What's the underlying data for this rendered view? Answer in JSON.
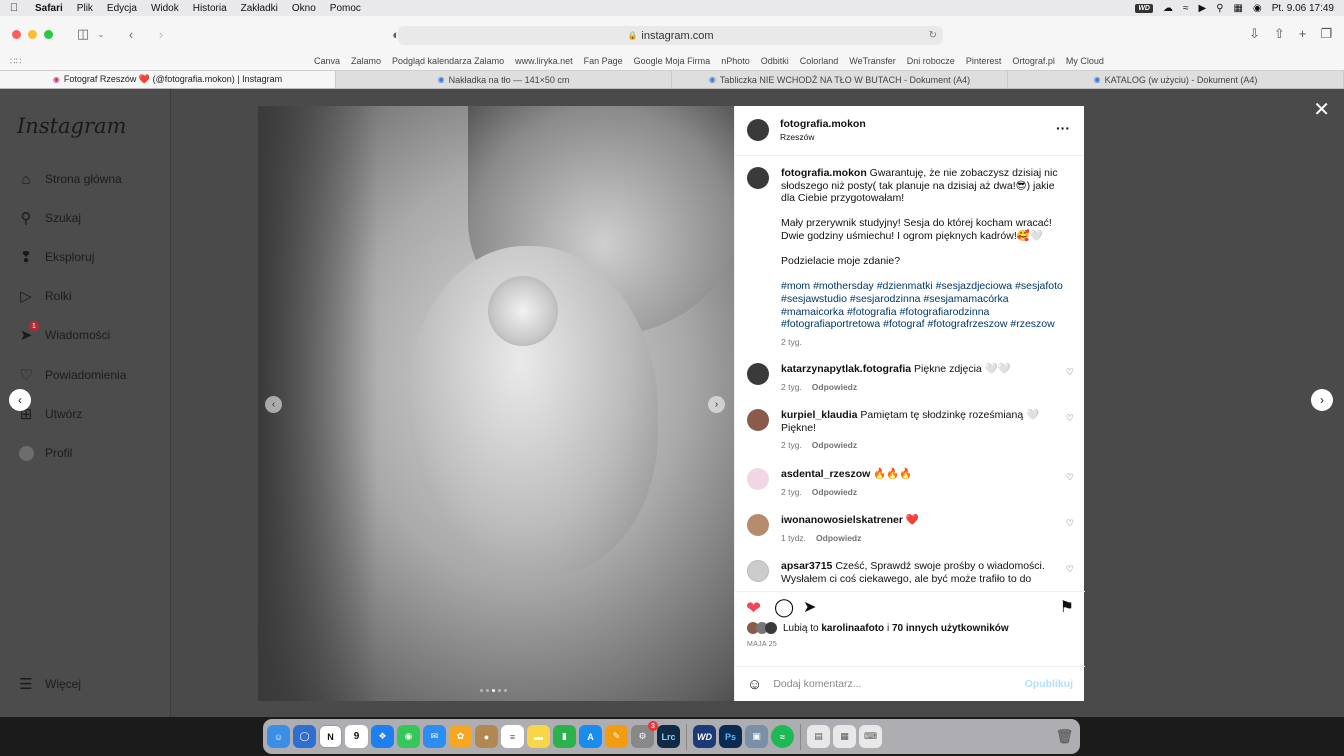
{
  "menubar": {
    "apple_icon": "apple-icon",
    "items": [
      "Safari",
      "Plik",
      "Edycja",
      "Widok",
      "Historia",
      "Zakładki",
      "Okno",
      "Pomoc"
    ],
    "wd_label": "WD",
    "datetime": "Pt. 9.06  17:49"
  },
  "toolbar": {
    "address": "instagram.com"
  },
  "favorites": [
    "Canva",
    "Zalamo",
    "Podgląd kalendarza Zalamo",
    "www.liryka.net",
    "Fan Page",
    "Google Moja Firma",
    "nPhoto",
    "Odbitki",
    "Colorland",
    "WeTransfer",
    "Dni robocze",
    "Pinterest",
    "Ortograf.pl",
    "My Cloud"
  ],
  "tabs": [
    {
      "label": "Fotograf Rzeszów ❤️ (@fotografia.mokon) | Instagram",
      "active": true
    },
    {
      "label": "Nakładka na tło — 141×50 cm",
      "active": false
    },
    {
      "label": "Tabliczka NIE WCHODŹ NA TŁO W BUTACH - Dokument (A4)",
      "active": false
    },
    {
      "label": "KATALOG (w użyciu) - Dokument (A4)",
      "active": false
    }
  ],
  "sidebar": {
    "logo": "Instagram",
    "items": [
      {
        "label": "Strona główna",
        "icon": "home-icon"
      },
      {
        "label": "Szukaj",
        "icon": "search-icon"
      },
      {
        "label": "Eksploruj",
        "icon": "compass-icon"
      },
      {
        "label": "Rolki",
        "icon": "reels-icon"
      },
      {
        "label": "Wiadomości",
        "icon": "messenger-icon",
        "badge": "1"
      },
      {
        "label": "Powiadomienia",
        "icon": "heart-icon"
      },
      {
        "label": "Utwórz",
        "icon": "plus-icon"
      },
      {
        "label": "Profil",
        "icon": "avatar"
      }
    ],
    "more": "Więcej"
  },
  "post": {
    "username": "fotografia.mokon",
    "location": "Rzeszów",
    "caption_p1": "Gwarantuję, że nie zobaczysz dzisiaj nic słodszego niż posty( tak planuje na dzisiaj aż dwa!😎) jakie dla Ciebie przygotowałam!",
    "caption_p2": "Mały przerywnik studyjny! Sesja do której kocham wracać! Dwie godziny uśmiechu! I ogrom pięknych kadrów!🥰🤍",
    "caption_p3": "Podzielacie moje zdanie?",
    "hashtags": "#mom #mothersday #dzienmatki #sesjazdjeciowa #sesjafoto #sesjawstudio #sesjarodzinna #sesjamamacórka #mamaicorka #fotografia #fotografiarodzinna #fotografiaportretowa #fotograf #fotografrzeszow #rzeszow",
    "caption_time": "2 tyg.",
    "comments": [
      {
        "user": "katarzynapytlak.fotografia",
        "text": "Piękne zdjęcia 🤍🤍",
        "time": "2 tyg.",
        "reply": "Odpowiedz"
      },
      {
        "user": "kurpiel_klaudia",
        "text": "Pamiętam tę słodzinkę roześmianą 🤍 Piękne!",
        "time": "2 tyg.",
        "reply": "Odpowiedz"
      },
      {
        "user": "asdental_rzeszow",
        "text": "🔥🔥🔥",
        "time": "2 tyg.",
        "reply": "Odpowiedz"
      },
      {
        "user": "iwonanowosielskatrener",
        "text": "❤️",
        "time": "1 tydz.",
        "reply": "Odpowiedz"
      },
      {
        "user": "apsar3715",
        "text": "Cześć, Sprawdź swoje prośby o wiadomości. Wysłałem ci coś ciekawego, ale być może trafiło to do",
        "time": "",
        "reply": ""
      }
    ],
    "likes_prefix": "Lubią to",
    "likes_user": "karolinaafoto",
    "likes_mid": "i",
    "likes_others": "70 innych użytkowników",
    "date": "MAJA 25",
    "comment_placeholder": "Dodaj komentarz...",
    "publish": "Opublikuj"
  },
  "dock": {
    "calendar_day": "9",
    "notification_badge": "3",
    "apps": [
      "finder-icon",
      "messenger-icon",
      "notion-icon",
      "calendar-icon",
      "safari-icon",
      "messages-icon",
      "mail-icon",
      "photos-icon",
      "contacts-icon",
      "reminders-icon",
      "notes-icon",
      "numbers-icon",
      "appstore-icon",
      "pages-icon",
      "settings-icon",
      "lightroom-icon",
      "wd-icon",
      "photoshop-icon",
      "preview-icon",
      "spotify-icon",
      "document-icon",
      "calculator-icon",
      "keyboard-icon",
      "trash-icon"
    ]
  },
  "colors": {
    "like_red": "#ed4956",
    "hashtag_blue": "#00376b",
    "publish_blue": "#b2dffc"
  }
}
